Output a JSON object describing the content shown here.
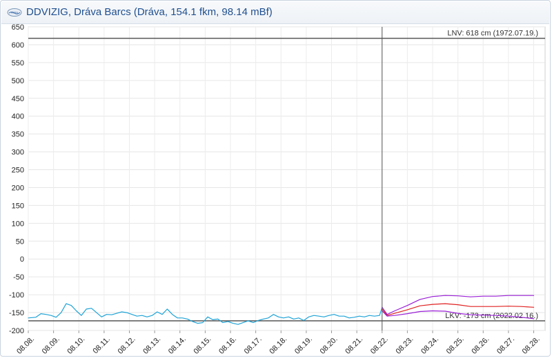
{
  "window": {
    "title": "DDVIZIG, Dráva Barcs (Dráva, 154.1 fkm, 98.14 mBf)",
    "logo_text": "VIZIG",
    "logo_icon": "ddvizig-logo-icon"
  },
  "chart_data": {
    "type": "line",
    "grid": true,
    "ylim": [
      -200,
      650
    ],
    "yticks": [
      650,
      600,
      550,
      500,
      450,
      400,
      350,
      300,
      250,
      200,
      150,
      100,
      50,
      0,
      -50,
      -100,
      -150,
      -200
    ],
    "xlim": [
      0,
      20.45
    ],
    "categories": [
      "08.08.",
      "08.09.",
      "08.10.",
      "08.11.",
      "08.12.",
      "08.13.",
      "08.14.",
      "08.15.",
      "08.16.",
      "08.17.",
      "08.18.",
      "08.19.",
      "08.20.",
      "08.21.",
      "08.22.",
      "08.23.",
      "08.24.",
      "08.25.",
      "08.26.",
      "08.27.",
      "08.28."
    ],
    "now_marker_x": 14.0,
    "reference_lines": [
      {
        "label": "LNV: 618 cm (1972.07.19.)",
        "value": 618,
        "color": "#555555"
      },
      {
        "label": "LKV: -173 cm (2022.02.16.)",
        "value": -173,
        "color": "#555555"
      }
    ],
    "series": [
      {
        "kind": "measured",
        "color": "#1fa3d6",
        "x": [
          0,
          0.3,
          0.5,
          0.7,
          0.9,
          1.1,
          1.3,
          1.5,
          1.7,
          1.9,
          2.1,
          2.3,
          2.5,
          2.7,
          2.9,
          3.1,
          3.3,
          3.5,
          3.7,
          3.9,
          4.1,
          4.3,
          4.5,
          4.7,
          4.9,
          5.1,
          5.3,
          5.5,
          5.7,
          5.9,
          6.1,
          6.3,
          6.5,
          6.7,
          6.9,
          7.1,
          7.3,
          7.5,
          7.7,
          7.9,
          8.1,
          8.3,
          8.5,
          8.7,
          8.9,
          9.1,
          9.3,
          9.5,
          9.7,
          9.9,
          10.1,
          10.3,
          10.5,
          10.7,
          10.9,
          11.1,
          11.3,
          11.5,
          11.7,
          11.9,
          12.1,
          12.3,
          12.5,
          12.7,
          12.9,
          13.1,
          13.3,
          13.5,
          13.7,
          13.9,
          14.0
        ],
        "y": [
          -165,
          -163,
          -153,
          -155,
          -158,
          -163,
          -150,
          -125,
          -130,
          -145,
          -158,
          -140,
          -138,
          -150,
          -162,
          -155,
          -156,
          -152,
          -148,
          -150,
          -155,
          -160,
          -158,
          -162,
          -158,
          -148,
          -155,
          -140,
          -155,
          -165,
          -165,
          -168,
          -175,
          -180,
          -178,
          -162,
          -170,
          -168,
          -178,
          -175,
          -180,
          -183,
          -178,
          -173,
          -178,
          -172,
          -168,
          -165,
          -155,
          -162,
          -165,
          -162,
          -168,
          -165,
          -172,
          -162,
          -158,
          -160,
          -162,
          -158,
          -155,
          -160,
          -160,
          -165,
          -163,
          -160,
          -162,
          -158,
          -160,
          -158,
          -135
        ]
      },
      {
        "kind": "forecast-max",
        "color": "#9a1fd6",
        "x": [
          14.0,
          14.2,
          14.5,
          15.0,
          15.5,
          16.0,
          16.5,
          17.0,
          17.5,
          18.0,
          18.5,
          19.0,
          19.5,
          20.0
        ],
        "y": [
          -135,
          -155,
          -145,
          -130,
          -113,
          -105,
          -102,
          -103,
          -106,
          -104,
          -104,
          -102,
          -102,
          -102
        ]
      },
      {
        "kind": "forecast",
        "color": "#e02020",
        "x": [
          14.0,
          14.2,
          14.5,
          15.0,
          15.5,
          16.0,
          16.5,
          17.0,
          17.5,
          18.0,
          18.5,
          19.0,
          19.5,
          20.0
        ],
        "y": [
          -140,
          -158,
          -152,
          -142,
          -131,
          -127,
          -125,
          -128,
          -133,
          -133,
          -133,
          -132,
          -133,
          -135
        ]
      },
      {
        "kind": "forecast-min",
        "color": "#9a1fd6",
        "x": [
          14.0,
          14.2,
          14.5,
          15.0,
          15.5,
          16.0,
          16.5,
          17.0,
          17.5,
          18.0,
          18.5,
          19.0,
          19.5,
          20.0
        ],
        "y": [
          -145,
          -160,
          -158,
          -153,
          -147,
          -145,
          -146,
          -152,
          -156,
          -157,
          -158,
          -160,
          -163,
          -167
        ]
      }
    ]
  }
}
